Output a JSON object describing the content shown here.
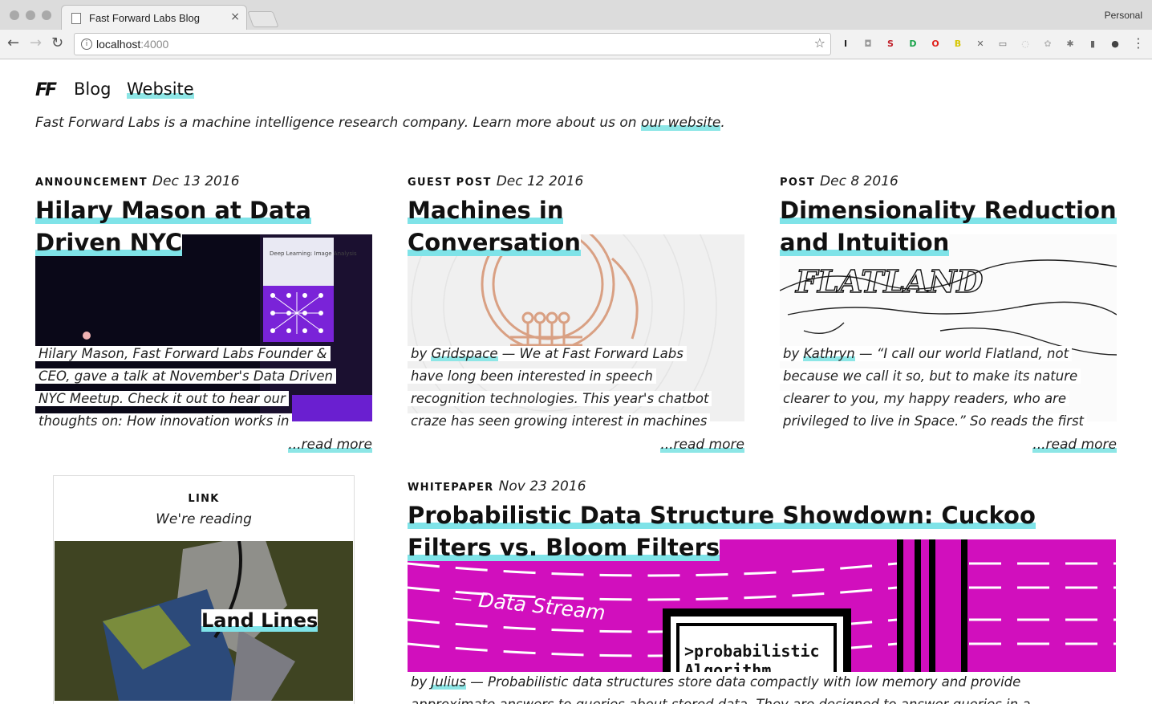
{
  "browser": {
    "tab_title": "Fast Forward Labs Blog",
    "tab_close": "×",
    "profile": "Personal",
    "url_host": "localhost",
    "url_port": ":4000",
    "info_glyph": "i",
    "star_glyph": "☆",
    "back_glyph": "←",
    "forward_glyph": "→",
    "reload_glyph": "↻",
    "menu_glyph": "⋮",
    "extensions": [
      {
        "name": "instapaper-icon",
        "glyph": "I",
        "color": "#222"
      },
      {
        "name": "camera-icon",
        "glyph": "◘",
        "color": "#999"
      },
      {
        "name": "s-extension-icon",
        "glyph": "S",
        "color": "#c0202a"
      },
      {
        "name": "green-d-extension-icon",
        "glyph": "D",
        "color": "#1aa34a"
      },
      {
        "name": "opera-icon",
        "glyph": "O",
        "color": "#e0201b"
      },
      {
        "name": "b-extension-icon",
        "glyph": "B",
        "color": "#d6c600"
      },
      {
        "name": "pin-icon",
        "glyph": "✕",
        "color": "#666"
      },
      {
        "name": "cast-icon",
        "glyph": "▭",
        "color": "#666"
      },
      {
        "name": "circle-extension-icon",
        "glyph": "◌",
        "color": "#bbb"
      },
      {
        "name": "gear-extension-icon",
        "glyph": "✿",
        "color": "#bbb"
      },
      {
        "name": "bug-icon",
        "glyph": "✱",
        "color": "#777"
      },
      {
        "name": "pdf-icon",
        "glyph": "▮",
        "color": "#666"
      },
      {
        "name": "ninja-icon",
        "glyph": "●",
        "color": "#444"
      }
    ]
  },
  "site": {
    "logo": "FF",
    "nav_blog": "Blog",
    "nav_website": "Website",
    "tagline_pre": "Fast Forward Labs is a machine intelligence research company. Learn more about us on ",
    "tagline_link": "our website",
    "tagline_post": "."
  },
  "posts": [
    {
      "kind": "ANNOUNCEMENT",
      "date": "Dec 13 2016",
      "title": "Hilary Mason at Data Driven NYC",
      "lines": [
        "Hilary Mason, Fast Forward Labs Founder &",
        "CEO, gave a talk at November's Data Driven",
        "NYC Meetup. Check it out to hear our",
        "thoughts on: How innovation works in"
      ],
      "read_more": "...read more",
      "slide_title": "Deep Learning: Image Analysis"
    },
    {
      "kind": "GUEST POST",
      "date": "Dec 12 2016",
      "title": "Machines in Conversation",
      "by": "by ",
      "author": "Gridspace",
      "lead": " — We at Fast Forward Labs",
      "lines": [
        "have long been interested in speech",
        "recognition technologies. This year's chatbot",
        "craze has seen growing interest in machines"
      ],
      "read_more": "...read more"
    },
    {
      "kind": "POST",
      "date": "Dec 8 2016",
      "title": "Dimensionality Reduction and Intuition",
      "by": "by ",
      "author": "Kathryn",
      "lead": " — “I call our world Flatland, not",
      "lines": [
        "because we call it so, but to make its nature",
        "clearer to you, my happy readers, who are",
        "privileged to live in Space.” So reads the first"
      ],
      "read_more": "...read more",
      "map_word": "FLATLAND"
    },
    {
      "kind": "WHITEPAPER",
      "date": "Nov 23 2016",
      "title": "Probabilistic Data Structure Showdown: Cuckoo Filters vs. Bloom Filters",
      "by": "by ",
      "author": "Julius",
      "lead": " — Probabilistic data structures store data compactly with low memory and provide",
      "line2": "approximate answers to queries about stored data. They are designed to answer queries in a",
      "art_stream": "— Data Stream",
      "art_box": ">probabilistic",
      "art_box2": "Algorithm"
    }
  ],
  "link_card": {
    "kind": "LINK",
    "sub": "We're reading",
    "title": "Land Lines"
  }
}
